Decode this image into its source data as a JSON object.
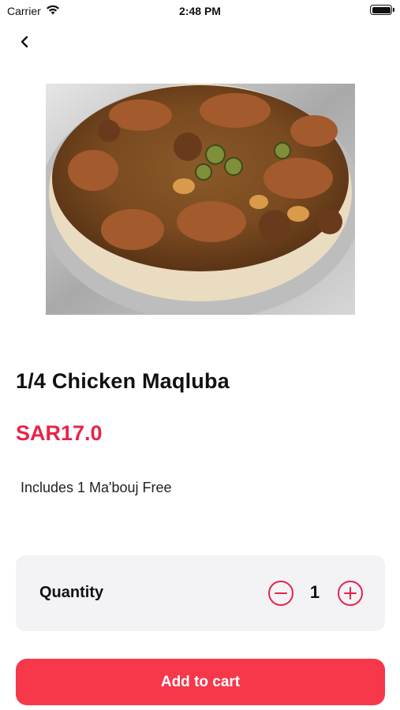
{
  "status_bar": {
    "carrier": "Carrier",
    "time": "2:48 PM",
    "icons": [
      "wifi-icon",
      "battery-icon"
    ]
  },
  "nav": {
    "back_icon": "chevron-left-icon"
  },
  "product": {
    "title": "1/4 Chicken Maqluba",
    "price": "SAR17.0",
    "description": "Includes 1 Ma'bouj Free"
  },
  "quantity": {
    "label": "Quantity",
    "value": "1",
    "decrement_icon": "minus-circle-icon",
    "increment_icon": "plus-circle-icon"
  },
  "cart": {
    "add_label": "Add to cart"
  },
  "colors": {
    "accent": "#e8234a",
    "button_bg": "#f7384a",
    "card_bg": "#f3f3f6"
  }
}
